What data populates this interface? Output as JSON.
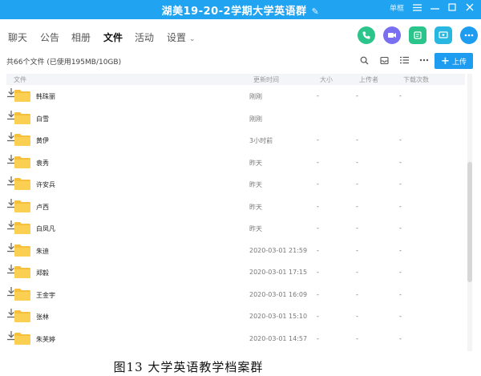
{
  "window": {
    "title": "湖美19-20-2学期大学英语群",
    "controls": {
      "pin_label": "单框"
    }
  },
  "nav": {
    "tabs": [
      {
        "label": "聊天"
      },
      {
        "label": "公告"
      },
      {
        "label": "相册"
      },
      {
        "label": "文件",
        "active": true
      },
      {
        "label": "活动"
      },
      {
        "label": "设置",
        "dropdown": true
      }
    ],
    "action_icons": [
      {
        "name": "phone-icon",
        "color": "#2bc48a"
      },
      {
        "name": "video-icon",
        "color": "#7a6ff0"
      },
      {
        "name": "app-icon",
        "color": "#2bc48a"
      },
      {
        "name": "screen-share-icon",
        "color": "#28b7e0"
      },
      {
        "name": "more-icon",
        "color": "#1e9cf0"
      }
    ]
  },
  "toolbar": {
    "storage": "共66个文件 (已使用195MB/10GB)",
    "upload_label": "上传",
    "icons": [
      "search-icon",
      "inbox-icon",
      "list-view-icon",
      "more-icon"
    ]
  },
  "table": {
    "headers": {
      "name": "文件",
      "updated": "更新时间",
      "size": "大小",
      "uploader": "上传者",
      "downloads": "下载次数"
    },
    "rows": [
      {
        "name": "韩珠丽",
        "updated": "刚刚",
        "size": "-",
        "uploader": "-",
        "downloads": "-"
      },
      {
        "name": "白雪",
        "updated": "刚刚",
        "size": "",
        "uploader": "",
        "downloads": ""
      },
      {
        "name": "黄伊",
        "updated": "3小时前",
        "size": "-",
        "uploader": "-",
        "downloads": "-"
      },
      {
        "name": "袁秀",
        "updated": "昨天",
        "size": "-",
        "uploader": "-",
        "downloads": "-"
      },
      {
        "name": "许安兵",
        "updated": "昨天",
        "size": "-",
        "uploader": "-",
        "downloads": "-"
      },
      {
        "name": "卢西",
        "updated": "昨天",
        "size": "-",
        "uploader": "-",
        "downloads": "-"
      },
      {
        "name": "白凤凡",
        "updated": "昨天",
        "size": "-",
        "uploader": "-",
        "downloads": "-"
      },
      {
        "name": "朱迪",
        "updated": "2020-03-01 21:59",
        "size": "-",
        "uploader": "-",
        "downloads": "-"
      },
      {
        "name": "郑毅",
        "updated": "2020-03-01 17:15",
        "size": "-",
        "uploader": "-",
        "downloads": "-"
      },
      {
        "name": "王金宇",
        "updated": "2020-03-01 16:09",
        "size": "-",
        "uploader": "-",
        "downloads": "-"
      },
      {
        "name": "张林",
        "updated": "2020-03-01 15:10",
        "size": "-",
        "uploader": "-",
        "downloads": "-"
      },
      {
        "name": "朱芙婷",
        "updated": "2020-03-01 14:57",
        "size": "-",
        "uploader": "-",
        "downloads": "-"
      }
    ]
  },
  "caption": "图13 大学英语教学档案群",
  "colors": {
    "titlebar": "#20a3f0",
    "accent": "#1e9cf0",
    "folder": "#f7c03c"
  }
}
